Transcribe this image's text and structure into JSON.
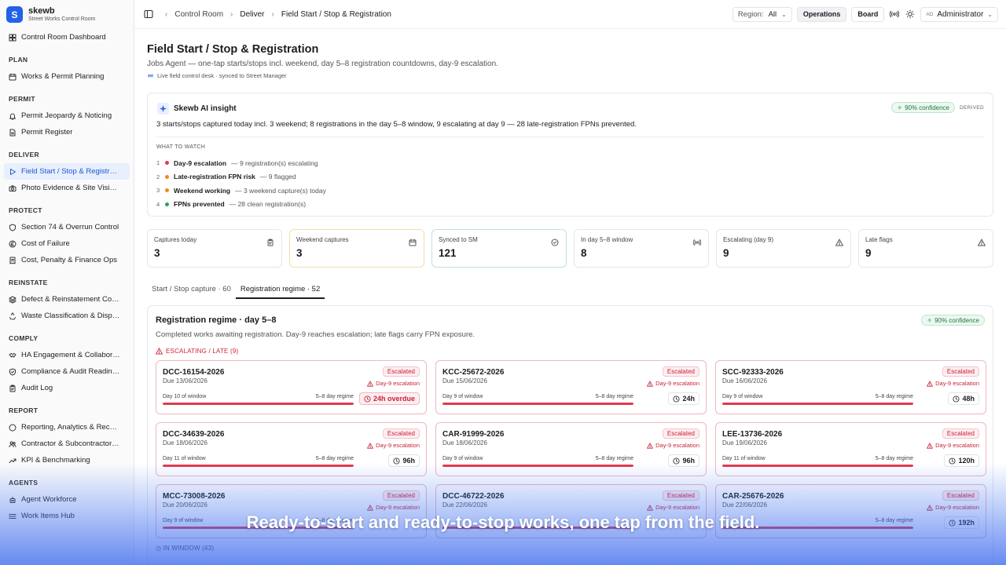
{
  "brand": {
    "name": "skewb",
    "tagline": "Street Works Control Room",
    "logo_letter": "S"
  },
  "sidebar": {
    "top_item": {
      "label": "Control Room Dashboard",
      "icon": "grid-icon"
    },
    "sections": [
      {
        "title": "PLAN",
        "items": [
          {
            "label": "Works & Permit Planning",
            "icon": "calendar-icon"
          }
        ]
      },
      {
        "title": "PERMIT",
        "items": [
          {
            "label": "Permit Jeopardy & Noticing",
            "icon": "bell-icon"
          },
          {
            "label": "Permit Register",
            "icon": "file-icon"
          }
        ]
      },
      {
        "title": "DELIVER",
        "items": [
          {
            "label": "Field Start / Stop & Registration",
            "icon": "play-icon",
            "active": true
          },
          {
            "label": "Photo Evidence & Site Visibility",
            "icon": "camera-icon"
          }
        ]
      },
      {
        "title": "PROTECT",
        "items": [
          {
            "label": "Section 74 & Overrun Control",
            "icon": "shield-icon"
          },
          {
            "label": "Cost of Failure",
            "icon": "pound-icon"
          },
          {
            "label": "Cost, Penalty & Finance Ops",
            "icon": "receipt-icon"
          }
        ]
      },
      {
        "title": "REINSTATE",
        "items": [
          {
            "label": "Defect & Reinstatement Control",
            "icon": "layers-icon"
          },
          {
            "label": "Waste Classification & Disposal",
            "icon": "recycle-icon"
          }
        ]
      },
      {
        "title": "COMPLY",
        "items": [
          {
            "label": "HA Engagement & Collaboration",
            "icon": "handshake-icon"
          },
          {
            "label": "Compliance & Audit Readiness",
            "icon": "shield-check-icon"
          },
          {
            "label": "Audit Log",
            "icon": "clipboard-icon"
          }
        ]
      },
      {
        "title": "REPORT",
        "items": [
          {
            "label": "Reporting, Analytics & Records",
            "icon": "chart-icon"
          },
          {
            "label": "Contractor & Subcontractor Performance",
            "icon": "users-icon"
          },
          {
            "label": "KPI & Benchmarking",
            "icon": "trend-icon"
          }
        ]
      },
      {
        "title": "AGENTS",
        "items": [
          {
            "label": "Agent Workforce",
            "icon": "bot-icon"
          },
          {
            "label": "Work Items Hub",
            "icon": "list-icon"
          }
        ]
      }
    ]
  },
  "topbar": {
    "breadcrumbs": [
      "Control Room",
      "Deliver",
      "Field Start / Stop & Registration"
    ],
    "region_label": "Region:",
    "region_value": "All",
    "operations_label": "Operations",
    "board_label": "Board",
    "user_initials": "AD",
    "user_name": "Administrator"
  },
  "page": {
    "title": "Field Start / Stop & Registration",
    "subtitle": "Jobs Agent — one-tap starts/stops incl. weekend, day 5–8 registration countdowns, day-9 escalation.",
    "live": "Live field control desk · synced to Street Manager"
  },
  "insight": {
    "title": "Skewb AI insight",
    "confidence": "90% confidence",
    "derived": "DERIVED",
    "body": "3 starts/stops captured today incl. 3 weekend; 8 registrations in the day 5–8 window, 9 escalating at day 9 — 28 late-registration FPNs prevented.",
    "watch_title": "WHAT TO WATCH",
    "watch": [
      {
        "n": "1",
        "title": "Day-9 escalation",
        "desc": "— 9 registration(s) escalating",
        "color": "#e23a4e"
      },
      {
        "n": "2",
        "title": "Late-registration FPN risk",
        "desc": "— 9 flagged",
        "color": "#ef8a1e"
      },
      {
        "n": "3",
        "title": "Weekend working",
        "desc": "— 3 weekend capture(s) today",
        "color": "#ef8a1e"
      },
      {
        "n": "4",
        "title": "FPNs prevented",
        "desc": "— 28 clean registration(s)",
        "color": "#22a55a"
      }
    ]
  },
  "stats": [
    {
      "label": "Captures today",
      "value": "3",
      "icon": "clipboard-icon",
      "tone": ""
    },
    {
      "label": "Weekend captures",
      "value": "3",
      "icon": "calendar-icon",
      "tone": "amber"
    },
    {
      "label": "Synced to SM",
      "value": "121",
      "icon": "check-circle-icon",
      "tone": "teal"
    },
    {
      "label": "In day 5–8 window",
      "value": "8",
      "icon": "signal-icon",
      "tone": ""
    },
    {
      "label": "Escalating (day 9)",
      "value": "9",
      "icon": "warning-icon",
      "tone": ""
    },
    {
      "label": "Late flags",
      "value": "9",
      "icon": "warning-icon",
      "tone": ""
    }
  ],
  "tabs": [
    {
      "label": "Start / Stop capture · 60",
      "active": false
    },
    {
      "label": "Registration regime · 52",
      "active": true
    }
  ],
  "panel": {
    "title": "Registration regime · day 5–8",
    "subtitle": "Completed works awaiting registration. Day-9 reaches escalation; late flags carry FPN exposure.",
    "confidence": "90% confidence",
    "escalating_heading": "ESCALATING / LATE (9)",
    "in_window_heading": "IN WINDOW (43)",
    "cards": [
      {
        "id": "DCC-16154-2026",
        "due": "Due 13/06/2026",
        "status": "Escalated",
        "esc": "Day-9 escalation",
        "window": "Day 10 of window",
        "regime": "5–8 day regime",
        "time": "24h overdue",
        "overdue": true,
        "progress": 1.0
      },
      {
        "id": "KCC-25672-2026",
        "due": "Due 15/06/2026",
        "status": "Escalated",
        "esc": "Day-9 escalation",
        "window": "Day 9 of window",
        "regime": "5–8 day regime",
        "time": "24h",
        "overdue": false,
        "progress": 1.0
      },
      {
        "id": "SCC-92333-2026",
        "due": "Due 16/06/2026",
        "status": "Escalated",
        "esc": "Day-9 escalation",
        "window": "Day 9 of window",
        "regime": "5–8 day regime",
        "time": "48h",
        "overdue": false,
        "progress": 1.0
      },
      {
        "id": "DCC-34639-2026",
        "due": "Due 18/06/2026",
        "status": "Escalated",
        "esc": "Day-9 escalation",
        "window": "Day 11 of window",
        "regime": "5–8 day regime",
        "time": "96h",
        "overdue": false,
        "progress": 1.0
      },
      {
        "id": "CAR-91999-2026",
        "due": "Due 18/06/2026",
        "status": "Escalated",
        "esc": "Day-9 escalation",
        "window": "Day 9 of window",
        "regime": "5–8 day regime",
        "time": "96h",
        "overdue": false,
        "progress": 1.0
      },
      {
        "id": "LEE-13736-2026",
        "due": "Due 19/06/2026",
        "status": "Escalated",
        "esc": "Day-9 escalation",
        "window": "Day 11 of window",
        "regime": "5–8 day regime",
        "time": "120h",
        "overdue": false,
        "progress": 1.0
      },
      {
        "id": "MCC-73008-2026",
        "due": "Due 20/06/2026",
        "status": "Escalated",
        "esc": "Day-9 escalation",
        "window": "Day 9 of window",
        "regime": "5–8 day regime",
        "time": "",
        "overdue": false,
        "progress": 1.0
      },
      {
        "id": "DCC-46722-2026",
        "due": "Due 22/06/2026",
        "status": "Escalated",
        "esc": "Day-9 escalation",
        "window": "",
        "regime": "",
        "time": "",
        "overdue": false,
        "progress": 1.0
      },
      {
        "id": "CAR-25676-2026",
        "due": "Due 22/06/2026",
        "status": "Escalated",
        "esc": "Day-9 escalation",
        "window": "",
        "regime": "5–8 day regime",
        "time": "192h",
        "overdue": false,
        "progress": 1.0
      }
    ]
  },
  "caption": "Ready-to-start and ready-to-stop works, one tap from the field."
}
